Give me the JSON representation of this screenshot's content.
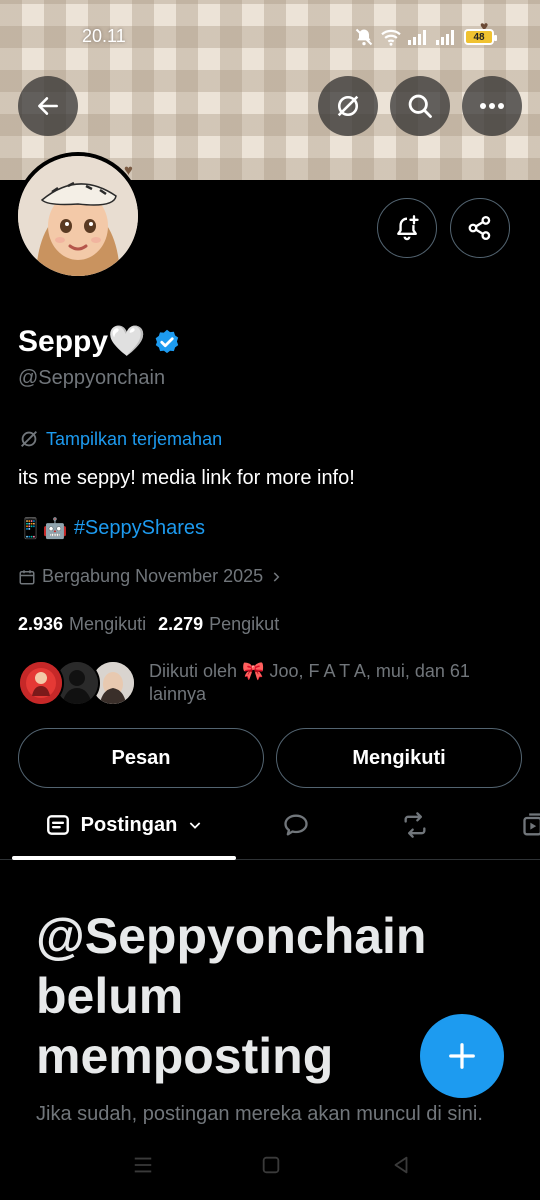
{
  "status_bar": {
    "time": "20.11",
    "battery": "48",
    "icons": [
      "mute-icon",
      "wifi-icon",
      "signal-icon",
      "signal-icon",
      "battery-icon"
    ]
  },
  "header": {
    "banner_pattern": "gingham-beige",
    "buttons": [
      "back-arrow-icon",
      "translate-icon",
      "search-icon",
      "more-icon"
    ]
  },
  "profile": {
    "display_name": "Seppy🤍",
    "handle": "@Seppyonchain",
    "verified": true,
    "translate_label": "Tampilkan terjemahan",
    "bio": "its me seppy! media link for more info!",
    "bio_emoji": "📱🤖",
    "hashtag": "#SeppyShares",
    "joined": "Bergabung November 2025",
    "following_count": "2.936",
    "following_label": "Mengikuti",
    "followers_count": "2.279",
    "followers_label": "Pengikut",
    "followed_by": "Diikuti oleh 🎀 Joo, F A T A, mui, dan 61 lainnya"
  },
  "actions": {
    "message_label": "Pesan",
    "following_label": "Mengikuti"
  },
  "tabs": {
    "posts_label": "Postingan",
    "icons": [
      "posts-icon",
      "replies-icon",
      "reposts-icon",
      "media-icon"
    ]
  },
  "empty_state": {
    "title": "@Seppyonchain belum memposting",
    "subtitle": "Jika sudah, postingan mereka akan muncul di sini."
  },
  "colors": {
    "accent": "#1d9bf0",
    "background": "#000000",
    "muted": "#71767b",
    "border": "#536471"
  }
}
